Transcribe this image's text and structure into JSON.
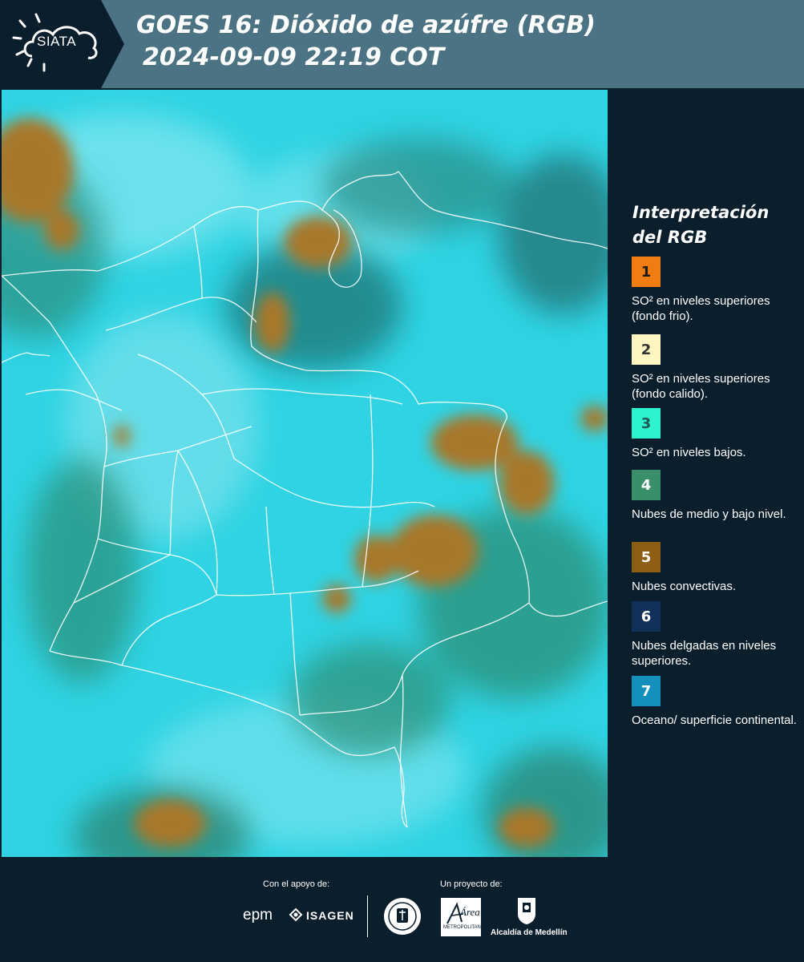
{
  "header": {
    "logo_text": "SIATA",
    "title_line1": "GOES 16: Dióxido de azúfre (RGB)",
    "title_line2": "2024-09-09 22:19 COT"
  },
  "legend": {
    "title": "Interpretación del RGB",
    "items": [
      {
        "number": "1",
        "color": "#f07d11",
        "number_color": "#1a1a1a",
        "description": "SO² en niveles superiores (fondo frio)."
      },
      {
        "number": "2",
        "color": "#fdf6c3",
        "number_color": "#333333",
        "description": "SO² en niveles superiores (fondo calido)."
      },
      {
        "number": "3",
        "color": "#2ff2cf",
        "number_color": "#1f5a56",
        "description": "SO² en niveles bajos."
      },
      {
        "number": "4",
        "color": "#3a8f6b",
        "number_color": "#ffffff",
        "description": "Nubes de medio y bajo nivel."
      },
      {
        "number": "5",
        "color": "#8e5e14",
        "number_color": "#ffffff",
        "description": "Nubes convectivas."
      },
      {
        "number": "6",
        "color": "#11305a",
        "number_color": "#ffffff",
        "description": "Nubes delgadas en niveles superiores."
      },
      {
        "number": "7",
        "color": "#1590bd",
        "number_color": "#ffffff",
        "description": "Oceano/ superficie continental."
      }
    ]
  },
  "footer": {
    "support_label": "Con el apoyo de:",
    "project_label": "Un proyecto de:",
    "sponsor_epm": "epm",
    "sponsor_isagen": "ISAGEN",
    "sponsor_area_name": "Área",
    "sponsor_area_sub": "METROPOLITANA",
    "sponsor_alcaldia": "Alcaldía de Medellín"
  },
  "colors": {
    "header_bg": "#4b7383",
    "dark_bg": "#0b1e2c",
    "map_cyan": "#2fd6e6",
    "cloud_brown": "#a07a2c",
    "cloud_green": "#2e8f74"
  }
}
